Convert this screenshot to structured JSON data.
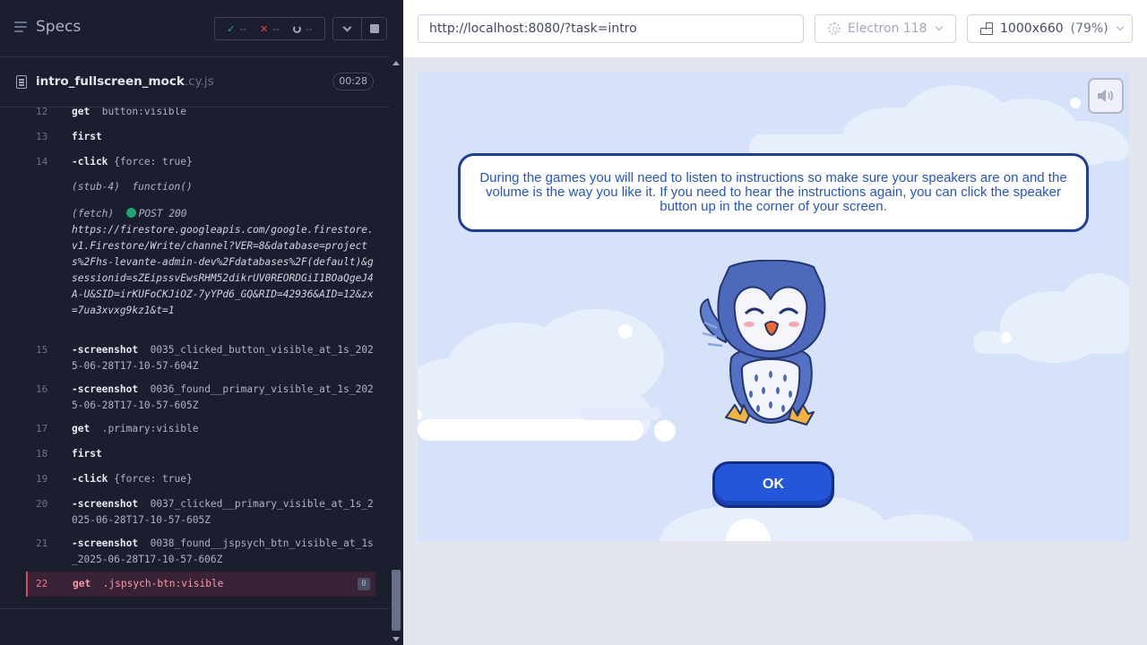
{
  "reporter": {
    "title": "Specs",
    "stats": {
      "passed": "--",
      "failed": "--",
      "pending": "--"
    },
    "spec": {
      "name": "intro_fullscreen_mock",
      "ext": ".cy.js",
      "duration": "00:28"
    },
    "commands": [
      {
        "num": "12",
        "name": "get",
        "arg": "button:visible"
      },
      {
        "num": "13",
        "name": "first",
        "arg": ""
      },
      {
        "num": "14",
        "name": "-click",
        "arg": "{force: true}"
      },
      {
        "stub": "(stub-4)",
        "stub_fn": "function()"
      },
      {
        "fetch_label": "(fetch)",
        "fetch_status": "POST 200",
        "fetch_url": "https://firestore.googleapis.com/google.firestore.v1.Firestore/Write/channel?VER=8&database=projects%2Fhs-levante-admin-dev%2Fdatabases%2F(default)&gsessionid=sZEipssvEwsRHM52dikrUV0REORDGiI1BOaQgeJ4A-U&SID=irKUFoCKJiOZ-7yYPd6_GQ&RID=42936&AID=12&zx=7ua3xvxg9kz1&t=1"
      },
      {
        "num": "15",
        "name": "-screenshot",
        "arg": "0035_clicked_button_visible_at_1s_2025-06-28T17-10-57-604Z"
      },
      {
        "num": "16",
        "name": "-screenshot",
        "arg": "0036_found__primary_visible_at_1s_2025-06-28T17-10-57-605Z"
      },
      {
        "num": "17",
        "name": "get",
        "arg": ".primary:visible"
      },
      {
        "num": "18",
        "name": "first",
        "arg": ""
      },
      {
        "num": "19",
        "name": "-click",
        "arg": "{force: true}"
      },
      {
        "num": "20",
        "name": "-screenshot",
        "arg": "0037_clicked__primary_visible_at_1s_2025-06-28T17-10-57-605Z"
      },
      {
        "num": "21",
        "name": "-screenshot",
        "arg": "0038_found__jspsych_btn_visible_at_1s_2025-06-28T17-10-57-606Z"
      },
      {
        "num": "22",
        "name": "get",
        "arg": ".jspsych-btn:visible",
        "badge": "0"
      }
    ]
  },
  "topbar": {
    "url": "http://localhost:8080/?task=intro",
    "browser": "Electron 118",
    "viewport": "1000x660",
    "viewport_pct": "(79%)"
  },
  "app": {
    "instructions": "During the games you will need to listen to instructions so make sure your speakers are on and the volume is the way you like it. If you need to hear the instructions again, you can click the speaker button up in the corner of your screen.",
    "ok_label": "OK"
  },
  "icons": {
    "menu": "hamburger-icon",
    "pass": "check-icon",
    "fail": "x-icon",
    "pending": "spinner-icon",
    "file": "file-icon",
    "browser": "gear-icon",
    "viewport": "ruler-icon",
    "sound": "speaker-icon"
  },
  "colors": {
    "reporter_bg": "#1b1e2e",
    "pass": "#29b36e",
    "fail": "#e4485c",
    "app_bg": "#d6e2fa",
    "ok_button": "#2356d8",
    "instruction_text": "#2455c8"
  }
}
